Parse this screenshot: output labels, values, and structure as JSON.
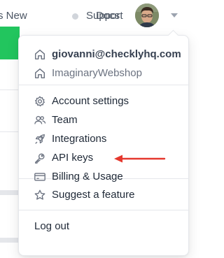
{
  "nav": {
    "whats_new": "s New",
    "support": "Support",
    "docs": "Docs"
  },
  "menu": {
    "accounts": [
      {
        "label": "giovanni@checklyhq.com",
        "icon": "home-icon",
        "active": true
      },
      {
        "label": "ImaginaryWebshop",
        "icon": "home-icon",
        "active": false
      }
    ],
    "settings": [
      {
        "label": "Account settings",
        "icon": "gear-icon"
      },
      {
        "label": "Team",
        "icon": "users-icon"
      },
      {
        "label": "Integrations",
        "icon": "rocket-icon"
      },
      {
        "label": "API keys",
        "icon": "key-icon"
      },
      {
        "label": "Billing & Usage",
        "icon": "credit-card-icon"
      }
    ],
    "suggest": {
      "label": "Suggest a feature",
      "icon": "star-icon"
    },
    "logout": {
      "label": "Log out"
    }
  },
  "annotation": {
    "color": "#e5382e",
    "points_to": "API keys"
  },
  "colors": {
    "brand_green": "#22c55e",
    "text": "#1f2937",
    "muted": "#6b7280",
    "border": "#e5e7eb"
  }
}
